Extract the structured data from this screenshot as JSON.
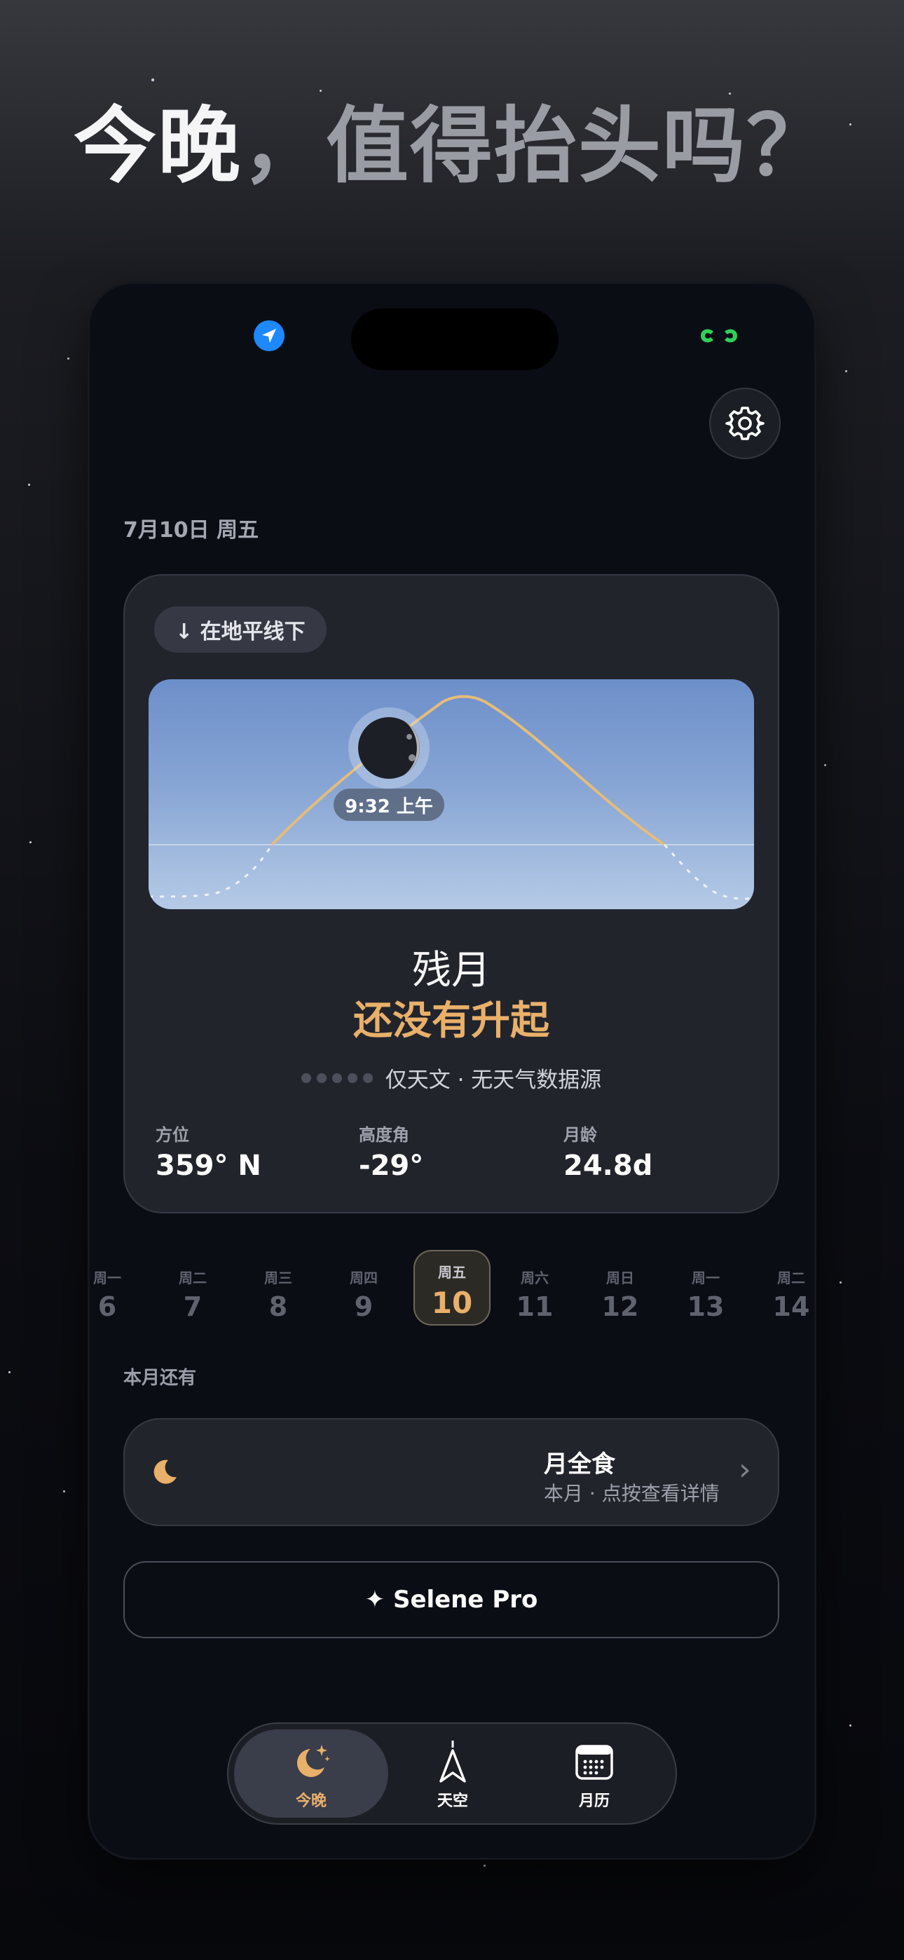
{
  "headline": {
    "part1": "今晚",
    "separator": "，",
    "part2": "值得抬头吗？"
  },
  "status_bar": {
    "location_icon": "location-arrow-icon",
    "battery_icon": "link-status-icon",
    "accent": "#1e88ff",
    "status_green": "#30d158"
  },
  "header": {
    "settings_icon": "gear-icon",
    "date": "7月10日 周五"
  },
  "moon_card": {
    "horizon_badge": "↓ 在地平线下",
    "rise_time": "9:32 上午",
    "phase_name": "残月",
    "status": "还没有升起",
    "source": "仅天文 · 无天气数据源",
    "stats": [
      {
        "label": "方位",
        "value": "359° N"
      },
      {
        "label": "高度角",
        "value": "-29°"
      },
      {
        "label": "月龄",
        "value": "24.8d"
      }
    ]
  },
  "week": [
    {
      "weekday": "周一",
      "day": "6"
    },
    {
      "weekday": "周二",
      "day": "7"
    },
    {
      "weekday": "周三",
      "day": "8"
    },
    {
      "weekday": "周四",
      "day": "9"
    },
    {
      "weekday": "周五",
      "day": "10",
      "selected": true
    },
    {
      "weekday": "周六",
      "day": "11"
    },
    {
      "weekday": "周日",
      "day": "12"
    },
    {
      "weekday": "周一",
      "day": "13"
    },
    {
      "weekday": "周二",
      "day": "14"
    }
  ],
  "month_section": {
    "label": "本月还有",
    "event_title": "月全食",
    "event_subtitle": "本月 · 点按查看详情",
    "event_icon": "crescent-moon-icon"
  },
  "pro_button": "✦ Selene Pro",
  "tabs": [
    {
      "label": "今晚",
      "icon": "moon-stars-icon",
      "active": true
    },
    {
      "label": "天空",
      "icon": "compass-arrow-icon"
    },
    {
      "label": "月历",
      "icon": "calendar-icon"
    }
  ],
  "colors": {
    "gold": "#e9b06a",
    "card": "#22242c",
    "background": "#0b0d15"
  }
}
